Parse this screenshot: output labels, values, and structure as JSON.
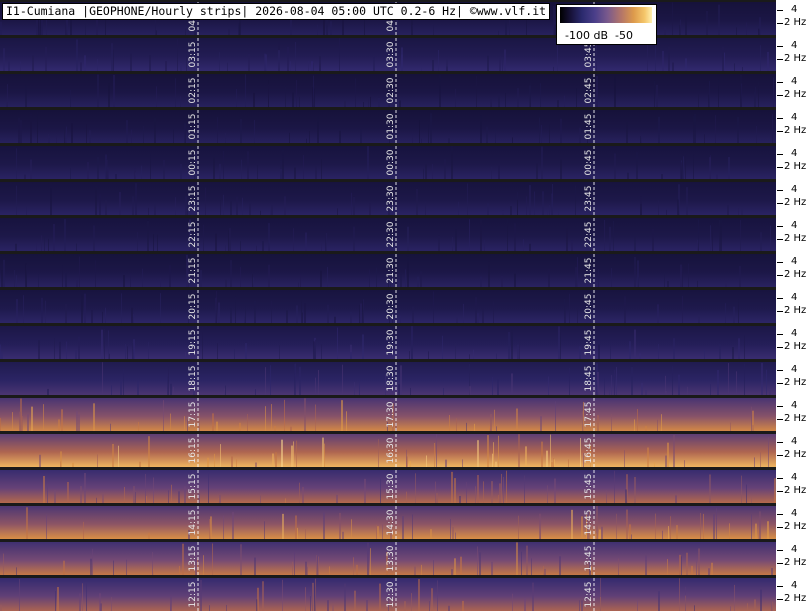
{
  "chart_data": {
    "type": "heatmap",
    "title": "I1-Cumiana |GEOPHONE/Hourly strips| 2026-08-04 05:00 UTC 0.2-6 Hz| ©www.vlf.it",
    "colorbar": {
      "labels": [
        "-100 dB",
        "-50"
      ],
      "range_db": [
        -100,
        -50
      ]
    },
    "y_tick_labels": [
      "4",
      "2 Hz"
    ],
    "strips": [
      {
        "hour": "04",
        "labels": [
          "04:15",
          "04:30",
          "04:45"
        ],
        "intensity": 0.12
      },
      {
        "hour": "03",
        "labels": [
          "03:15",
          "03:30",
          "03:45"
        ],
        "intensity": 0.18
      },
      {
        "hour": "02",
        "labels": [
          "02:15",
          "02:30",
          "02:45"
        ],
        "intensity": 0.12
      },
      {
        "hour": "01",
        "labels": [
          "01:15",
          "01:30",
          "01:45"
        ],
        "intensity": 0.12
      },
      {
        "hour": "00",
        "labels": [
          "00:15",
          "00:30",
          "00:45"
        ],
        "intensity": 0.14
      },
      {
        "hour": "23",
        "labels": [
          "23:15",
          "23:30",
          "23:45"
        ],
        "intensity": 0.14
      },
      {
        "hour": "22",
        "labels": [
          "22:15",
          "22:30",
          "22:45"
        ],
        "intensity": 0.14
      },
      {
        "hour": "21",
        "labels": [
          "21:15",
          "21:30",
          "21:45"
        ],
        "intensity": 0.13
      },
      {
        "hour": "20",
        "labels": [
          "20:15",
          "20:30",
          "20:45"
        ],
        "intensity": 0.15
      },
      {
        "hour": "19",
        "labels": [
          "19:15",
          "19:30",
          "19:45"
        ],
        "intensity": 0.2
      },
      {
        "hour": "18",
        "labels": [
          "18:15",
          "18:30",
          "18:45"
        ],
        "intensity": 0.25
      },
      {
        "hour": "17",
        "labels": [
          "17:15",
          "17:30",
          "17:45"
        ],
        "intensity": 0.6
      },
      {
        "hour": "16",
        "labels": [
          "16:15",
          "16:30",
          "16:45"
        ],
        "intensity": 0.72
      },
      {
        "hour": "15",
        "labels": [
          "15:15",
          "15:30",
          "15:45"
        ],
        "intensity": 0.5
      },
      {
        "hour": "14",
        "labels": [
          "14:15",
          "14:30",
          "14:45"
        ],
        "intensity": 0.62
      },
      {
        "hour": "13",
        "labels": [
          "13:15",
          "13:30",
          "13:45"
        ],
        "intensity": 0.55
      },
      {
        "hour": "12",
        "labels": [
          "12:15",
          "12:30",
          "12:45"
        ],
        "intensity": 0.48
      }
    ]
  }
}
